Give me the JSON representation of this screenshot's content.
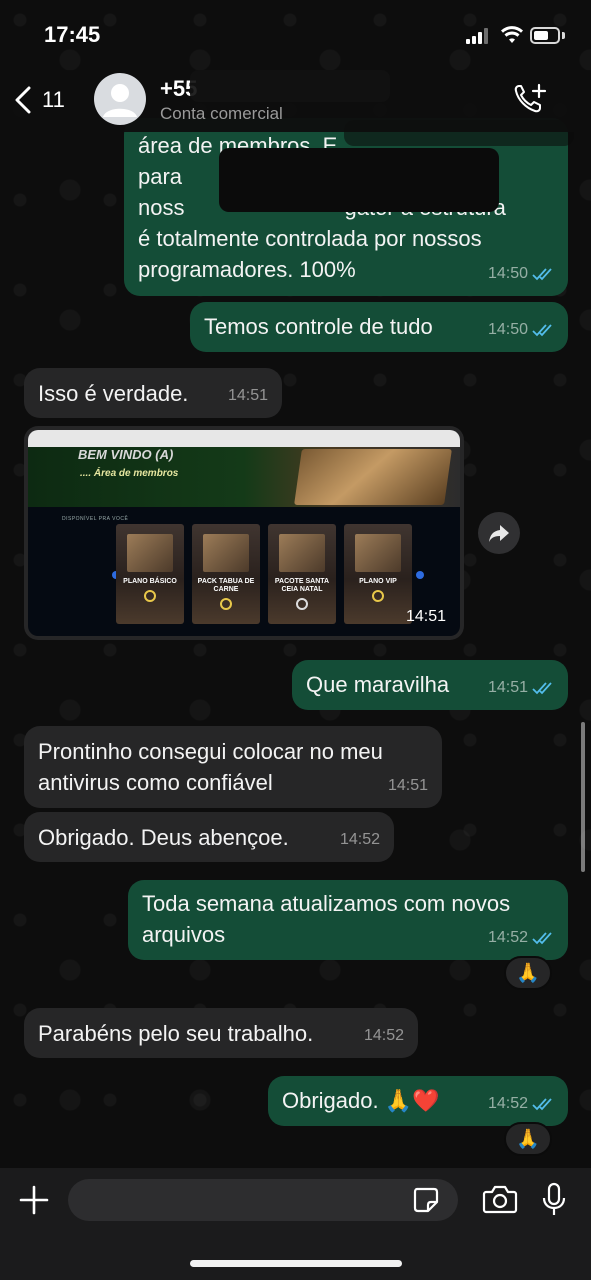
{
  "status_bar": {
    "time": "17:45"
  },
  "header": {
    "back_count": "11",
    "contact_name": "+55",
    "contact_subtitle": "Conta comercial"
  },
  "messages": [
    {
      "direction": "outgoing",
      "lines": [
        "área de membros. E",
        "para",
        "noss",
        "é totalmente controlada por nossos",
        "programadores. 100%"
      ],
      "line3_tail": "gator a estrutura",
      "time": "14:50",
      "status": "read"
    },
    {
      "direction": "outgoing",
      "text": "Temos controle de tudo",
      "time": "14:50",
      "status": "read"
    },
    {
      "direction": "incoming",
      "text": "Isso é verdade.",
      "time": "14:51"
    },
    {
      "direction": "incoming",
      "type": "image",
      "time": "14:51",
      "image": {
        "banner_title": "BEM VINDO (A)",
        "banner_subtitle": "....  Área de membros",
        "section_label": "DISPONÍVEL PRA VOCÊ",
        "products": [
          "PLANO BÁSICO",
          "PACK TABUA DE CARNE",
          "PACOTE SANTA CEIA NATAL",
          "PLANO VIP"
        ]
      }
    },
    {
      "direction": "outgoing",
      "text": "Que maravilha",
      "time": "14:51",
      "status": "read"
    },
    {
      "direction": "incoming",
      "lines": [
        "Prontinho consegui colocar no meu",
        "antivirus como confiável"
      ],
      "time": "14:51"
    },
    {
      "direction": "incoming",
      "text": "Obrigado. Deus abençoe.",
      "time": "14:52"
    },
    {
      "direction": "outgoing",
      "lines": [
        "Toda semana atualizamos com novos",
        "arquivos"
      ],
      "time": "14:52",
      "status": "read",
      "reaction": "🙏"
    },
    {
      "direction": "incoming",
      "text": "Parabéns pelo seu trabalho.",
      "time": "14:52"
    },
    {
      "direction": "outgoing",
      "text": "Obrigado. 🙏❤️",
      "time": "14:52",
      "status": "read",
      "reaction": "🙏"
    }
  ],
  "composer": {
    "placeholder": ""
  },
  "colors": {
    "outgoing_bubble": "#144d37",
    "incoming_bubble": "#262627",
    "read_ticks": "#53bdeb"
  },
  "icons": [
    "back-chevron-icon",
    "avatar-icon",
    "call-add-icon",
    "forward-icon",
    "plus-icon",
    "sticker-icon",
    "camera-icon",
    "microphone-icon"
  ]
}
